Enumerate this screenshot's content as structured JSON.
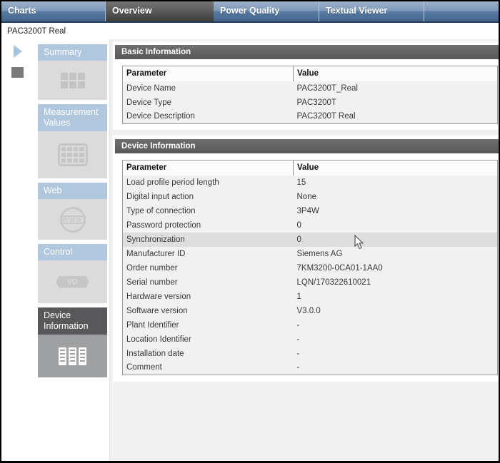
{
  "tabs": [
    {
      "label": "Charts",
      "active": false
    },
    {
      "label": "Overview",
      "active": true
    },
    {
      "label": "Power Quality",
      "active": false
    },
    {
      "label": "Textual Viewer",
      "active": false
    }
  ],
  "device_label": "PAC3200T Real",
  "side_controls": {
    "play_icon": "play-arrow",
    "stop_icon": "stop-square"
  },
  "sidebar": {
    "items": [
      {
        "label": "Summary",
        "icon": "summary-grid-icon",
        "selected": false
      },
      {
        "label": "Measurement Values",
        "icon": "measurement-table-icon",
        "selected": false
      },
      {
        "label": "Web",
        "icon": "www-globe-icon",
        "selected": false
      },
      {
        "label": "Control",
        "icon": "io-control-icon",
        "selected": false
      },
      {
        "label": "Device Information",
        "icon": "device-docs-icon",
        "selected": true
      }
    ]
  },
  "sections": [
    {
      "title": "Basic Information",
      "columns": [
        "Parameter",
        "Value"
      ],
      "rows": [
        {
          "parameter": "Device Name",
          "value": "PAC3200T_Real",
          "hover": false
        },
        {
          "parameter": "Device Type",
          "value": "PAC3200T",
          "hover": false
        },
        {
          "parameter": "Device Description",
          "value": "PAC3200T Real",
          "hover": false
        }
      ]
    },
    {
      "title": "Device Information",
      "columns": [
        "Parameter",
        "Value"
      ],
      "rows": [
        {
          "parameter": "Load profile period length",
          "value": "15",
          "hover": false
        },
        {
          "parameter": "Digital input action",
          "value": "None",
          "hover": false
        },
        {
          "parameter": "Type of connection",
          "value": "3P4W",
          "hover": false
        },
        {
          "parameter": "Password protection",
          "value": "0",
          "hover": false
        },
        {
          "parameter": "Synchronization",
          "value": "0",
          "hover": true
        },
        {
          "parameter": "Manufacturer ID",
          "value": "Siemens AG",
          "hover": false
        },
        {
          "parameter": "Order number",
          "value": "7KM3200-0CA01-1AA0",
          "hover": false
        },
        {
          "parameter": "Serial number",
          "value": "LQN/170322610021",
          "hover": false
        },
        {
          "parameter": "Hardware version",
          "value": "1",
          "hover": false
        },
        {
          "parameter": "Software version",
          "value": "V3.0.0",
          "hover": false
        },
        {
          "parameter": "Plant Identifier",
          "value": "-",
          "hover": false
        },
        {
          "parameter": "Location Identifier",
          "value": "-",
          "hover": false
        },
        {
          "parameter": "Installation date",
          "value": "-",
          "hover": false
        },
        {
          "parameter": "Comment",
          "value": "-",
          "hover": false
        }
      ]
    }
  ],
  "colors": {
    "tab_bar_blue": "#5E82A8",
    "active_tab_gray": "#4A4A4A",
    "section_header_gray": "#636363",
    "sidebar_header_blue": "#B0C7DD",
    "selected_tile_gray": "#58585A",
    "table_row_gray": "#F1F1F1",
    "row_hover_gray": "#DEDEDE"
  }
}
